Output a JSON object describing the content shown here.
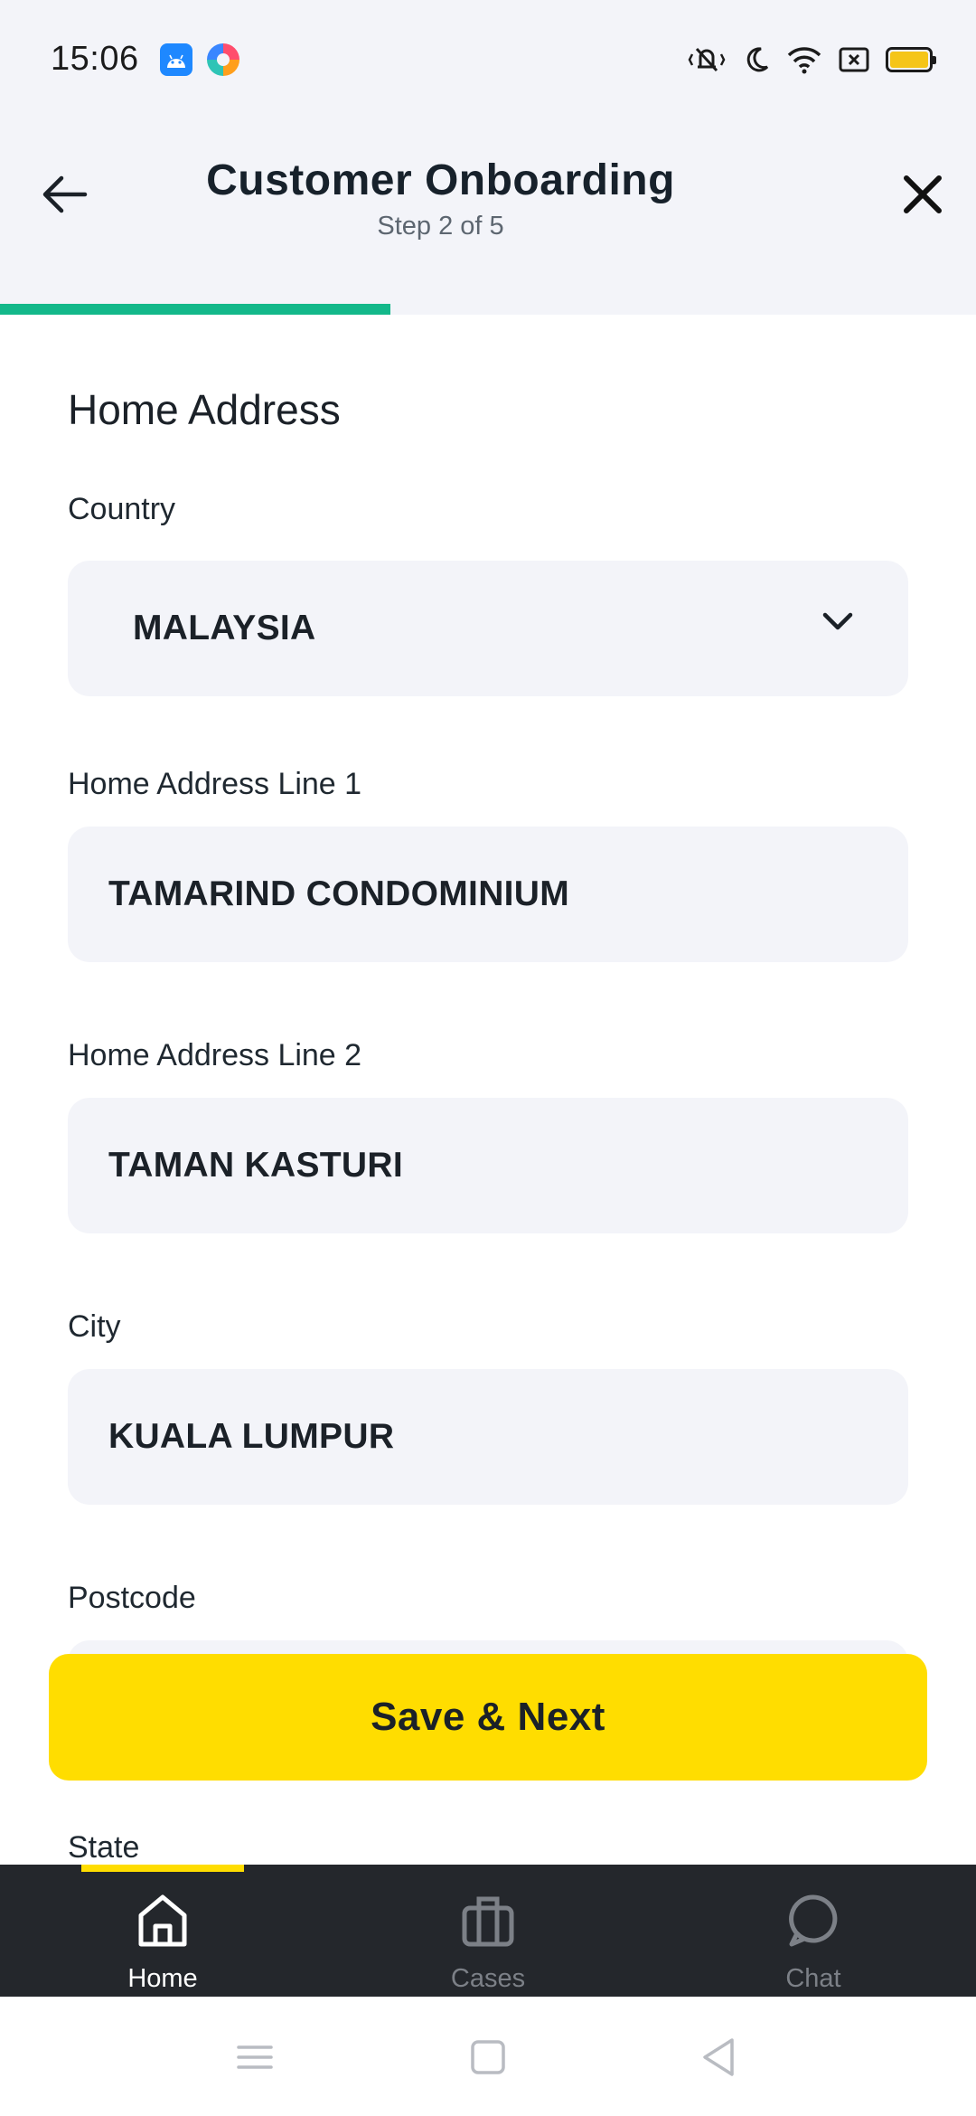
{
  "status_bar": {
    "time": "15:06",
    "left_icons": [
      "android-app-icon",
      "browser-app-icon"
    ],
    "right_icons": [
      "vibrate-icon",
      "moon-icon",
      "wifi-icon",
      "sim-icon",
      "battery-icon"
    ],
    "battery_color": "#f5c518"
  },
  "header": {
    "title": "Customer Onboarding",
    "subtitle": "Step 2 of 5",
    "progress_fraction": 0.4,
    "progress_color": "#13b88a",
    "back_icon": "arrow-left-icon",
    "close_icon": "close-icon"
  },
  "form": {
    "section_title": "Home Address",
    "country": {
      "label": "Country",
      "value": "MALAYSIA"
    },
    "address_line_1": {
      "label": "Home Address Line 1",
      "value": "TAMARIND CONDOMINIUM"
    },
    "address_line_2": {
      "label": "Home Address Line 2",
      "value": "TAMAN KASTURI"
    },
    "city": {
      "label": "City",
      "value": "KUALA LUMPUR"
    },
    "postcode": {
      "label": "Postcode",
      "value": ""
    },
    "state": {
      "label": "State"
    }
  },
  "actions": {
    "save_next_label": "Save & Next",
    "accent": "#ffdd00"
  },
  "bottom_nav": {
    "items": [
      {
        "label": "Home",
        "icon": "home-icon",
        "active": true
      },
      {
        "label": "Cases",
        "icon": "briefcase-icon",
        "active": false
      },
      {
        "label": "Chat",
        "icon": "chat-bubble-icon",
        "active": false
      }
    ],
    "background": "#24272c"
  },
  "system_nav": {
    "buttons": [
      "menu-icon",
      "home-square-icon",
      "back-triangle-icon"
    ]
  }
}
